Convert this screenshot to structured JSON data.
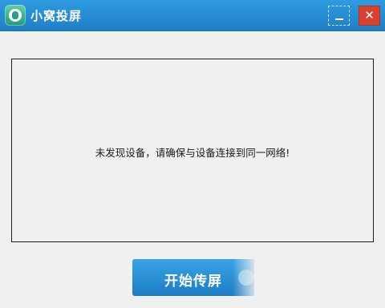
{
  "window": {
    "title": "小窝投屏",
    "minimize_icon": "minimize-icon",
    "close_icon": "close-icon",
    "close_glyph": "✕",
    "accent_color": "#1f7fc7",
    "close_color": "#d9412f"
  },
  "panel": {
    "message": "未发现设备，请确保与设备连接到同一网络!"
  },
  "actions": {
    "start_label": "开始传屏"
  }
}
